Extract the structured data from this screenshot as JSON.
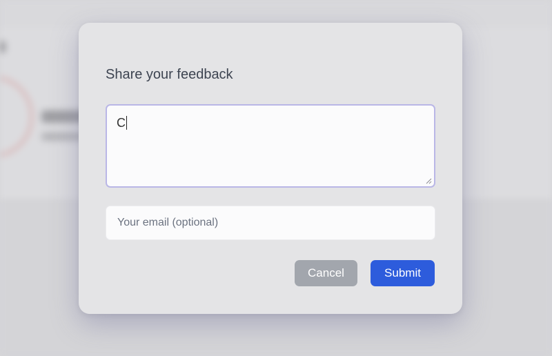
{
  "modal": {
    "title": "Share your feedback",
    "feedback_value": "C",
    "email_placeholder": "Your email (optional)",
    "cancel_label": "Cancel",
    "submit_label": "Submit"
  },
  "colors": {
    "submit": "#2d5cdc",
    "cancel": "#a2a6ad",
    "focus_border": "#b9b6e6",
    "overlay": "#d6d6d9"
  },
  "icons": {
    "textarea_resize": "resize-handle-icon"
  }
}
